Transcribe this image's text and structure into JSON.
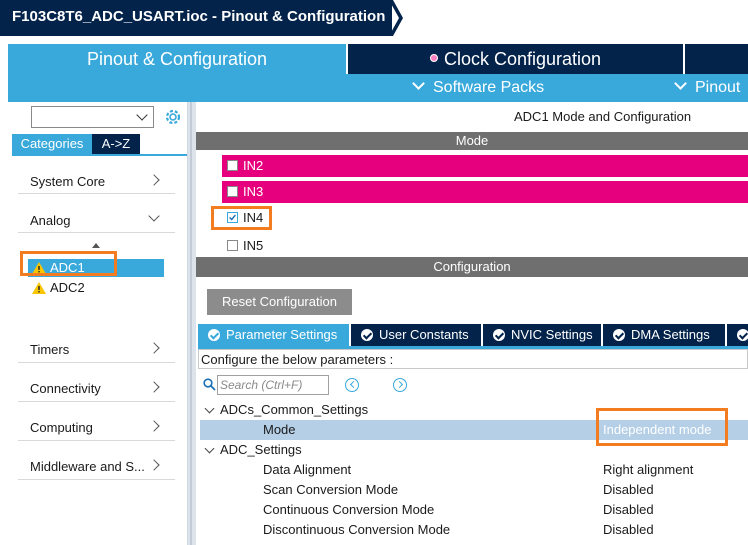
{
  "title": "F103C8T6_ADC_USART.ioc - Pinout & Configuration",
  "main_tabs": {
    "pinout": "Pinout & Configuration",
    "clock": "Clock Configuration"
  },
  "subbar": {
    "software_packs": "Software Packs",
    "pinout": "Pinout"
  },
  "left": {
    "tab_categories": "Categories",
    "tab_az": "A->Z",
    "categories": {
      "system_core": "System Core",
      "analog": "Analog",
      "timers": "Timers",
      "connectivity": "Connectivity",
      "computing": "Computing",
      "middleware": "Middleware and S..."
    },
    "analog_items": {
      "adc1": "ADC1",
      "adc2": "ADC2"
    }
  },
  "mode_panel": {
    "title": "ADC1 Mode and Configuration",
    "header": "Mode",
    "inputs": {
      "in2": "IN2",
      "in3": "IN3",
      "in4": "IN4",
      "in5": "IN5"
    }
  },
  "config_panel": {
    "header": "Configuration",
    "reset_button": "Reset Configuration",
    "tabs": {
      "parameter": "Parameter Settings",
      "user_constants": "User Constants",
      "nvic": "NVIC Settings",
      "dma": "DMA Settings"
    },
    "hint": "Configure the below parameters :",
    "search_placeholder": "Search (Ctrl+F)",
    "tree": {
      "common": "ADCs_Common_Settings",
      "mode_label": "Mode",
      "mode_value": "Independent mode",
      "adc_settings": "ADC_Settings",
      "data_alignment": "Data Alignment",
      "data_alignment_value": "Right alignment",
      "scan": "Scan Conversion Mode",
      "scan_value": "Disabled",
      "continuous": "Continuous Conversion Mode",
      "continuous_value": "Disabled",
      "discontinuous": "Discontinuous Conversion Mode",
      "discontinuous_value": "Disabled"
    }
  },
  "colors": {
    "navy": "#03234b",
    "accent_blue": "#39a9dc",
    "magenta": "#e6007e",
    "highlight_orange": "#f47c20"
  }
}
